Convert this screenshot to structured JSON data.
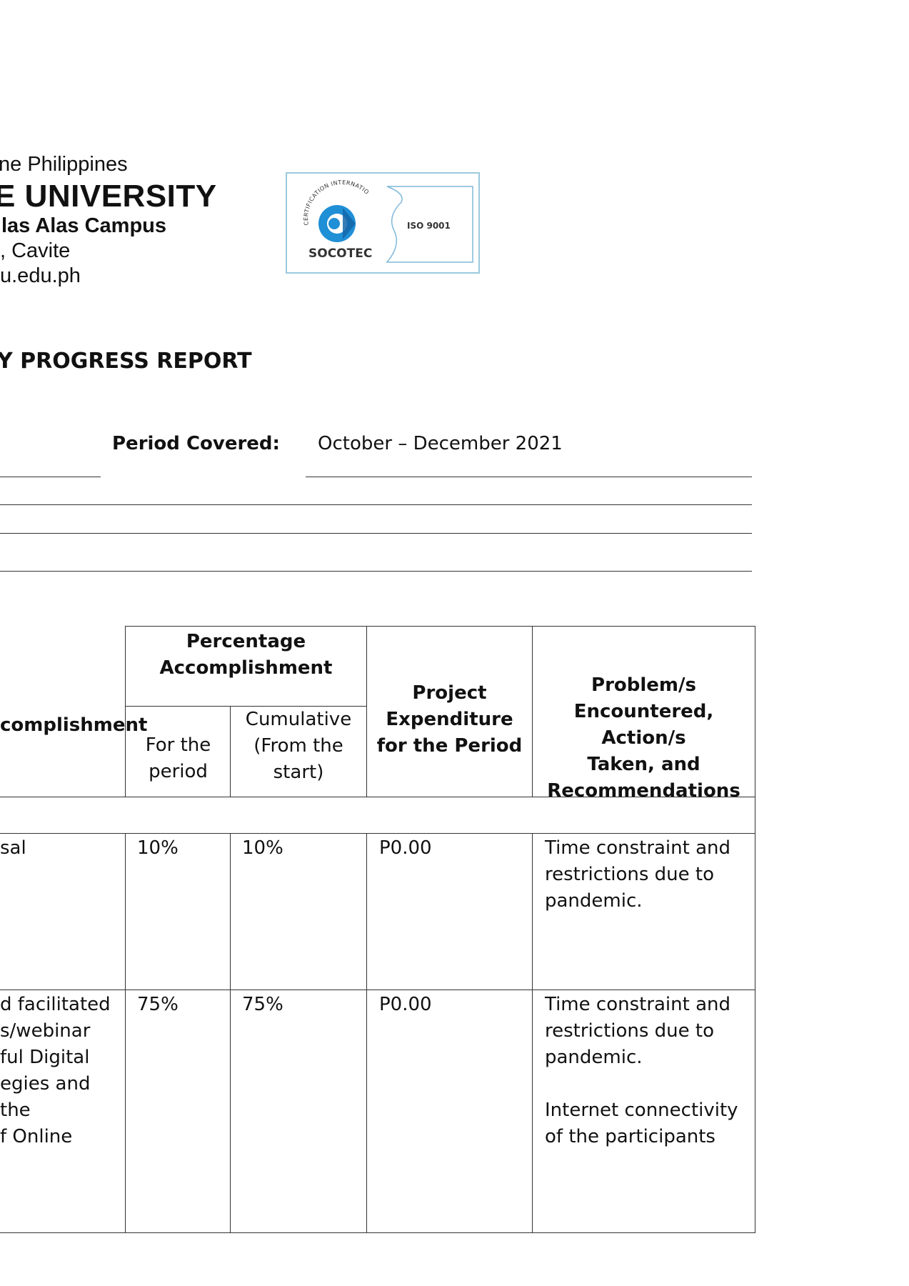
{
  "header": {
    "country": "ne Philippines",
    "university": "E UNIVERSITY",
    "campus": "las Alas Campus",
    "location": ", Cavite",
    "website": "u.edu.ph"
  },
  "logo": {
    "ring_text": "CERTIFICATION INTERNATIONAL",
    "brand": "SOCOTEC",
    "standard": "ISO 9001",
    "color": "#1f8fd6"
  },
  "report_title": "Y PROGRESS REPORT",
  "period": {
    "label": "Period Covered:",
    "value": "October – December 2021"
  },
  "table": {
    "headers": {
      "accomplishment": "complishment",
      "percentage_line1": "Percentage",
      "percentage_line2": "Accomplishment",
      "for_period_line1": "For the",
      "for_period_line2": "period",
      "cumulative_line1": "Cumulative",
      "cumulative_line2": "(From the",
      "cumulative_line3": "start)",
      "expenditure_line1": "Project",
      "expenditure_line2": "Expenditure",
      "expenditure_line3": "for the Period",
      "problems_line1": "Problem/s",
      "problems_line2": "Encountered, Action/s",
      "problems_line3": "Taken, and",
      "problems_line4": "Recommendations"
    },
    "rows": [
      {
        "accomplishment": [
          "sal"
        ],
        "for_period": "10%",
        "cumulative": "10%",
        "expenditure": "P0.00",
        "problems": [
          "Time constraint and",
          "restrictions due to",
          "pandemic."
        ]
      },
      {
        "accomplishment": [
          "d facilitated",
          "s/webinar",
          "ful Digital",
          "egies and the",
          "f Online"
        ],
        "for_period": "75%",
        "cumulative": "75%",
        "expenditure": "P0.00",
        "problems": [
          "Time constraint and",
          "restrictions due to",
          "pandemic.",
          "",
          "Internet connectivity",
          "of the participants"
        ]
      }
    ]
  }
}
